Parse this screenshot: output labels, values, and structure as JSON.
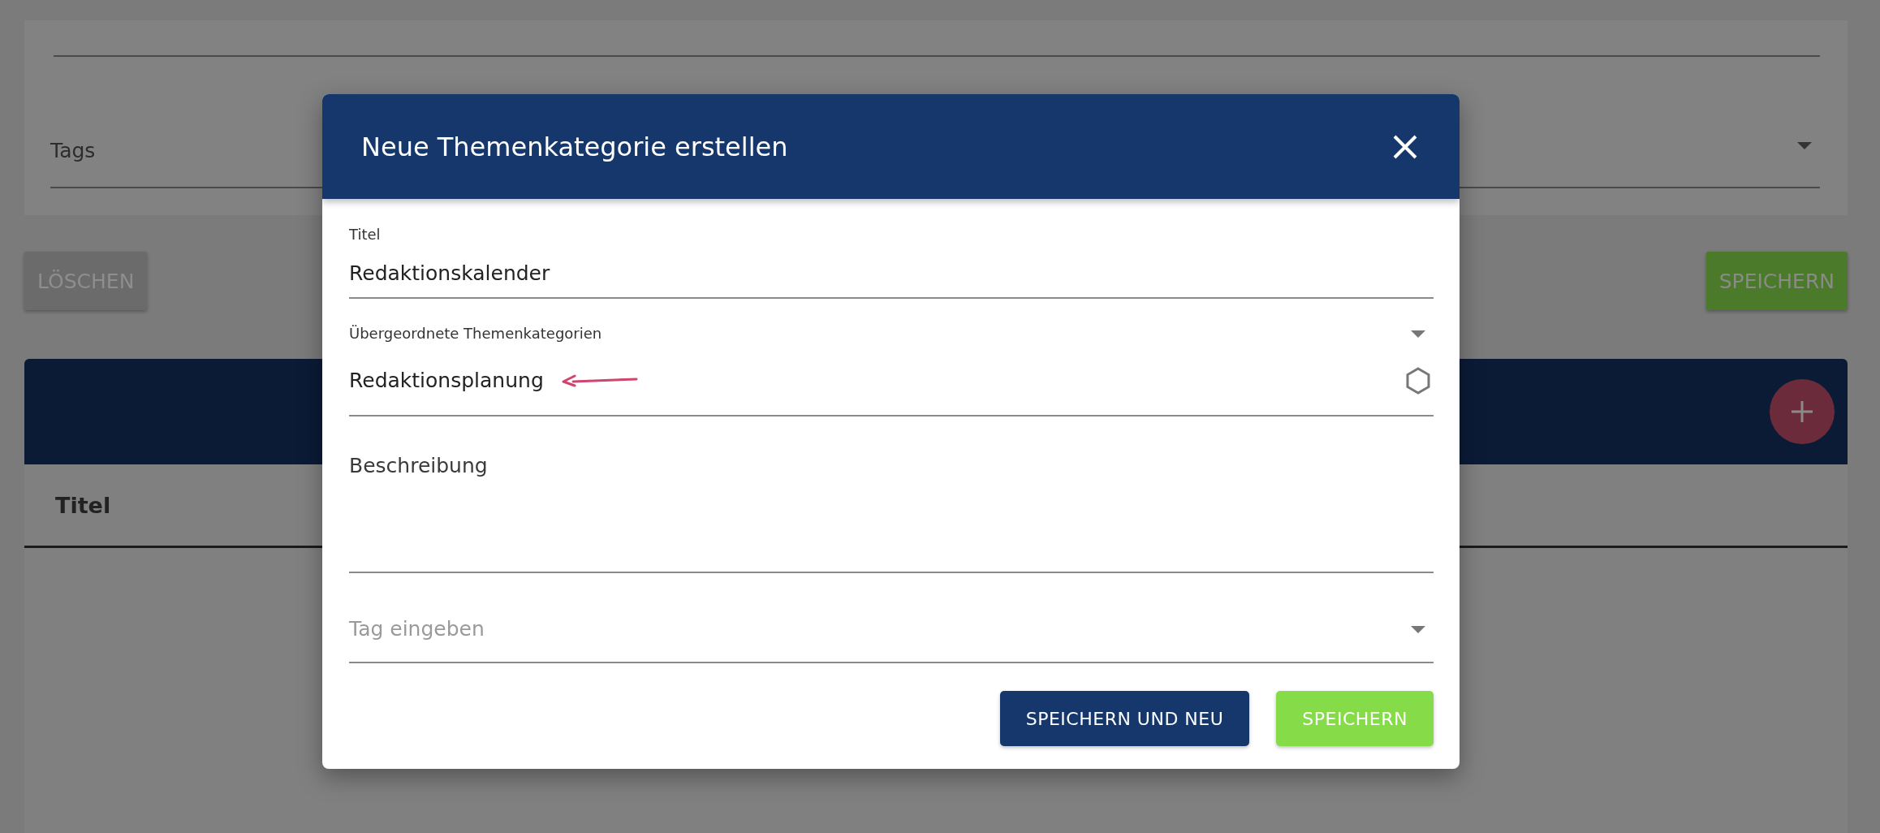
{
  "background": {
    "tags_field": {
      "label": "Tags"
    },
    "buttons": [
      {
        "label": "LÖSCHEN",
        "kind": "delete"
      },
      {
        "label": "SPEICHERN",
        "kind": "save"
      }
    ],
    "table": {
      "columns": [
        "Titel"
      ]
    }
  },
  "dialog": {
    "title": "Neue Themenkategorie erstellen",
    "fields": [
      {
        "kind": "text",
        "label": "Titel",
        "value": "Redaktionskalender"
      },
      {
        "kind": "select",
        "label": "Übergeordnete Themenkategorien",
        "value": "Redaktionsplanung"
      },
      {
        "kind": "textarea",
        "label": "Beschreibung"
      },
      {
        "kind": "tags",
        "placeholder": "Tag eingeben"
      }
    ],
    "buttons": [
      {
        "label": "SPEICHERN UND NEU",
        "kind": "secondary"
      },
      {
        "label": "SPEICHERN",
        "kind": "primary"
      }
    ]
  }
}
